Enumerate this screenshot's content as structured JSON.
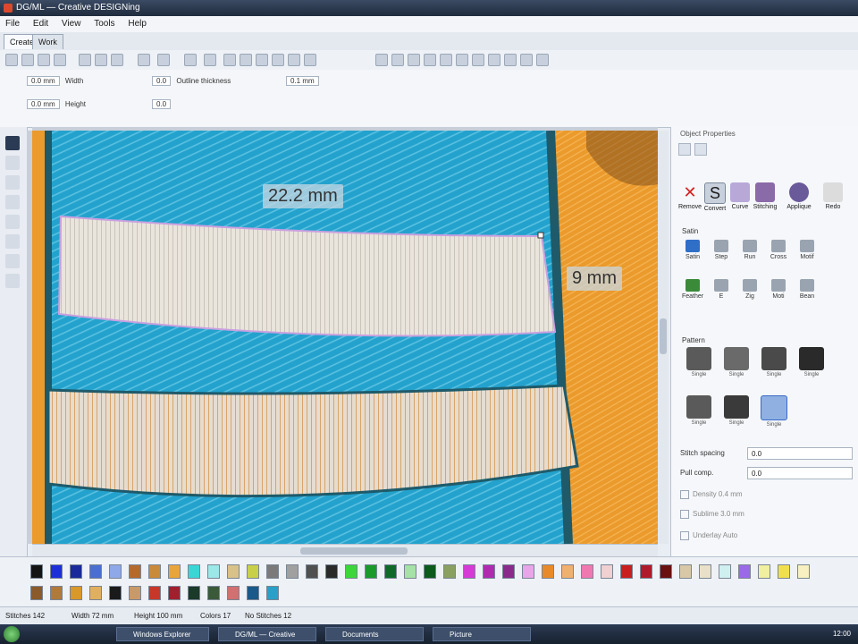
{
  "window": {
    "title": "DG/ML — Creative DESIGNing"
  },
  "menu": [
    "File",
    "Edit",
    "View",
    "Tools",
    "Help"
  ],
  "tabs": [
    "Create",
    "Work"
  ],
  "properties": {
    "row1": {
      "pos": "0.0 mm",
      "width_label": "Width",
      "angle": "0.0",
      "border_label": "Outline thickness",
      "border_val": "0.1 mm"
    },
    "row2": {
      "pos": "0.0 mm",
      "height_label": "Height",
      "angle": "0.0"
    }
  },
  "canvas": {
    "measure_width": "22.2 mm",
    "measure_height": "9 mm",
    "colors": {
      "blue": "#23a2cd",
      "orange": "#eb9a2c",
      "white": "#eae2d6"
    }
  },
  "panel": {
    "title": "Object Properties",
    "top_tools": [
      "Remove",
      "Convert",
      "Curve",
      "Stitching",
      "Applique",
      "Redo"
    ],
    "stitch_section": "Satin",
    "stitch_types": [
      "Satin",
      "Step",
      "Run",
      "Cross",
      "Motif",
      "Feather",
      "E",
      "Zig",
      "Moti",
      "Bean"
    ],
    "pattern_section": "Pattern",
    "patterns": [
      "Single",
      "Single",
      "Single",
      "Single",
      "Single",
      "Single",
      "Single"
    ],
    "fields": [
      {
        "label": "Stitch spacing",
        "value": "0.0"
      },
      {
        "label": "Pull comp.",
        "value": "0.0"
      }
    ],
    "checks": [
      {
        "label": "Density",
        "value": "0.4 mm"
      },
      {
        "label": "Sublime",
        "value": "3.0 mm"
      },
      {
        "label": "Underlay",
        "value": "Auto"
      }
    ]
  },
  "palette": {
    "row1": [
      "#141414",
      "#1d2fd6",
      "#1a2a9a",
      "#4b6fd0",
      "#8ea8e8",
      "#b56a2c",
      "#c98a3a",
      "#e8a63a",
      "#3ad6d6",
      "#9ce8e8",
      "#d8c28a",
      "#c8d04a",
      "#7a7a7a",
      "#a0a0a0",
      "#505050",
      "#2a2a2a",
      "#3ad63a",
      "#1a9a2a",
      "#0f6a2a",
      "#a6e2a6",
      "#0c5a1c",
      "#8aa060",
      "#d63ad6",
      "#b02ab0",
      "#8a2a8a",
      "#e8a6e8",
      "#e88a2a",
      "#f0b070",
      "#f078b0",
      "#f0d0d0",
      "#c81e1e",
      "#b01a2a",
      "#6a1010",
      "#d8c8a8",
      "#e8e0c8",
      "#d0f0f0",
      "#9a6ae8",
      "#f0f0a0",
      "#f0e050",
      "#f8f0c0"
    ],
    "row2": [
      "#8a5a2a",
      "#b07a3a",
      "#d8982a",
      "#e0b060",
      "#1a1a1a",
      "#c89a6a",
      "#c8382a",
      "#a02030",
      "#1a3a2a",
      "#3a5a3a",
      "#d07070",
      "#1a5a8a",
      "#2aa0c8"
    ]
  },
  "status": {
    "stitches": "Stitches 142",
    "width": "Width 72 mm",
    "height": "Height 100 mm",
    "colors": "Colors 17",
    "selection": "No Stitches 12"
  },
  "taskbar": {
    "items": [
      "Start",
      "Windows Explorer",
      "DG/ML — Creative",
      "Documents",
      "Picture"
    ],
    "clock": "12:00"
  }
}
